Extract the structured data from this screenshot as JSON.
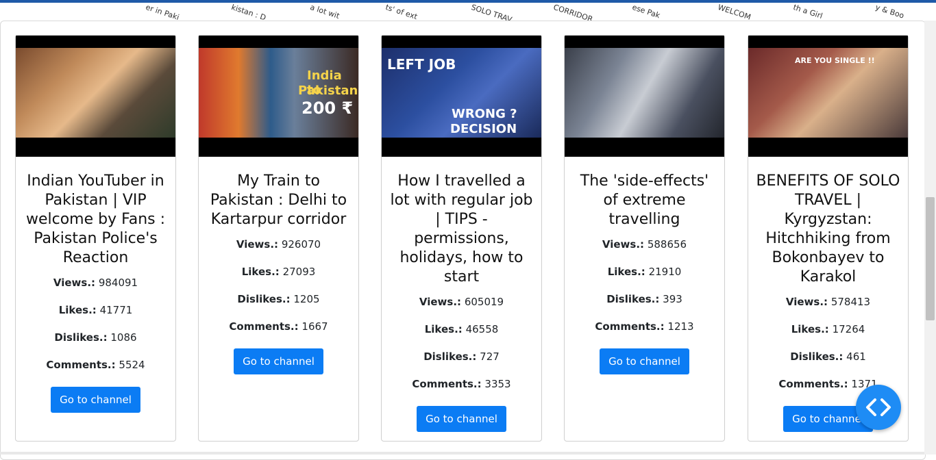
{
  "ticker": [
    "er in Paki",
    "kistan : D",
    "a lot wit",
    "ts' of ext",
    "SOLO TRAV",
    "CORRIDOR",
    "ese Pak",
    "WELCOM",
    "th a Girl",
    "y & Boo"
  ],
  "button_label": "Go to channel",
  "labels": {
    "views": "Views.:",
    "likes": "Likes.:",
    "dislikes": "Dislikes.:",
    "comments": "Comments.:"
  },
  "cards": [
    {
      "title": "Indian YouTuber in Pakistan | VIP welcome by Fans : Pakistan Police's Reaction",
      "views": "984091",
      "likes": "41771",
      "dislikes": "1086",
      "comments": "5524"
    },
    {
      "title": "My Train to Pakistan : Delhi to Kartarpur corridor",
      "views": "926070",
      "likes": "27093",
      "dislikes": "1205",
      "comments": "1667",
      "thumb_text": [
        "India to",
        "Pakistan",
        "200 ₹"
      ]
    },
    {
      "title": "How I travelled a lot with regular job | TIPS - permissions, holidays, how to start",
      "views": "605019",
      "likes": "46558",
      "dislikes": "727",
      "comments": "3353",
      "thumb_text": [
        "LEFT JOB",
        "WRONG ?",
        "DECISION"
      ]
    },
    {
      "title": "The 'side-effects' of extreme travelling",
      "views": "588656",
      "likes": "21910",
      "dislikes": "393",
      "comments": "1213"
    },
    {
      "title": "BENEFITS OF SOLO TRAVEL | Kyrgyzstan: Hitchhiking from Bokonbayev to Karakol",
      "views": "578413",
      "likes": "17264",
      "dislikes": "461",
      "comments": "1371",
      "thumb_text": [
        "ARE YOU SINGLE !!"
      ]
    }
  ]
}
